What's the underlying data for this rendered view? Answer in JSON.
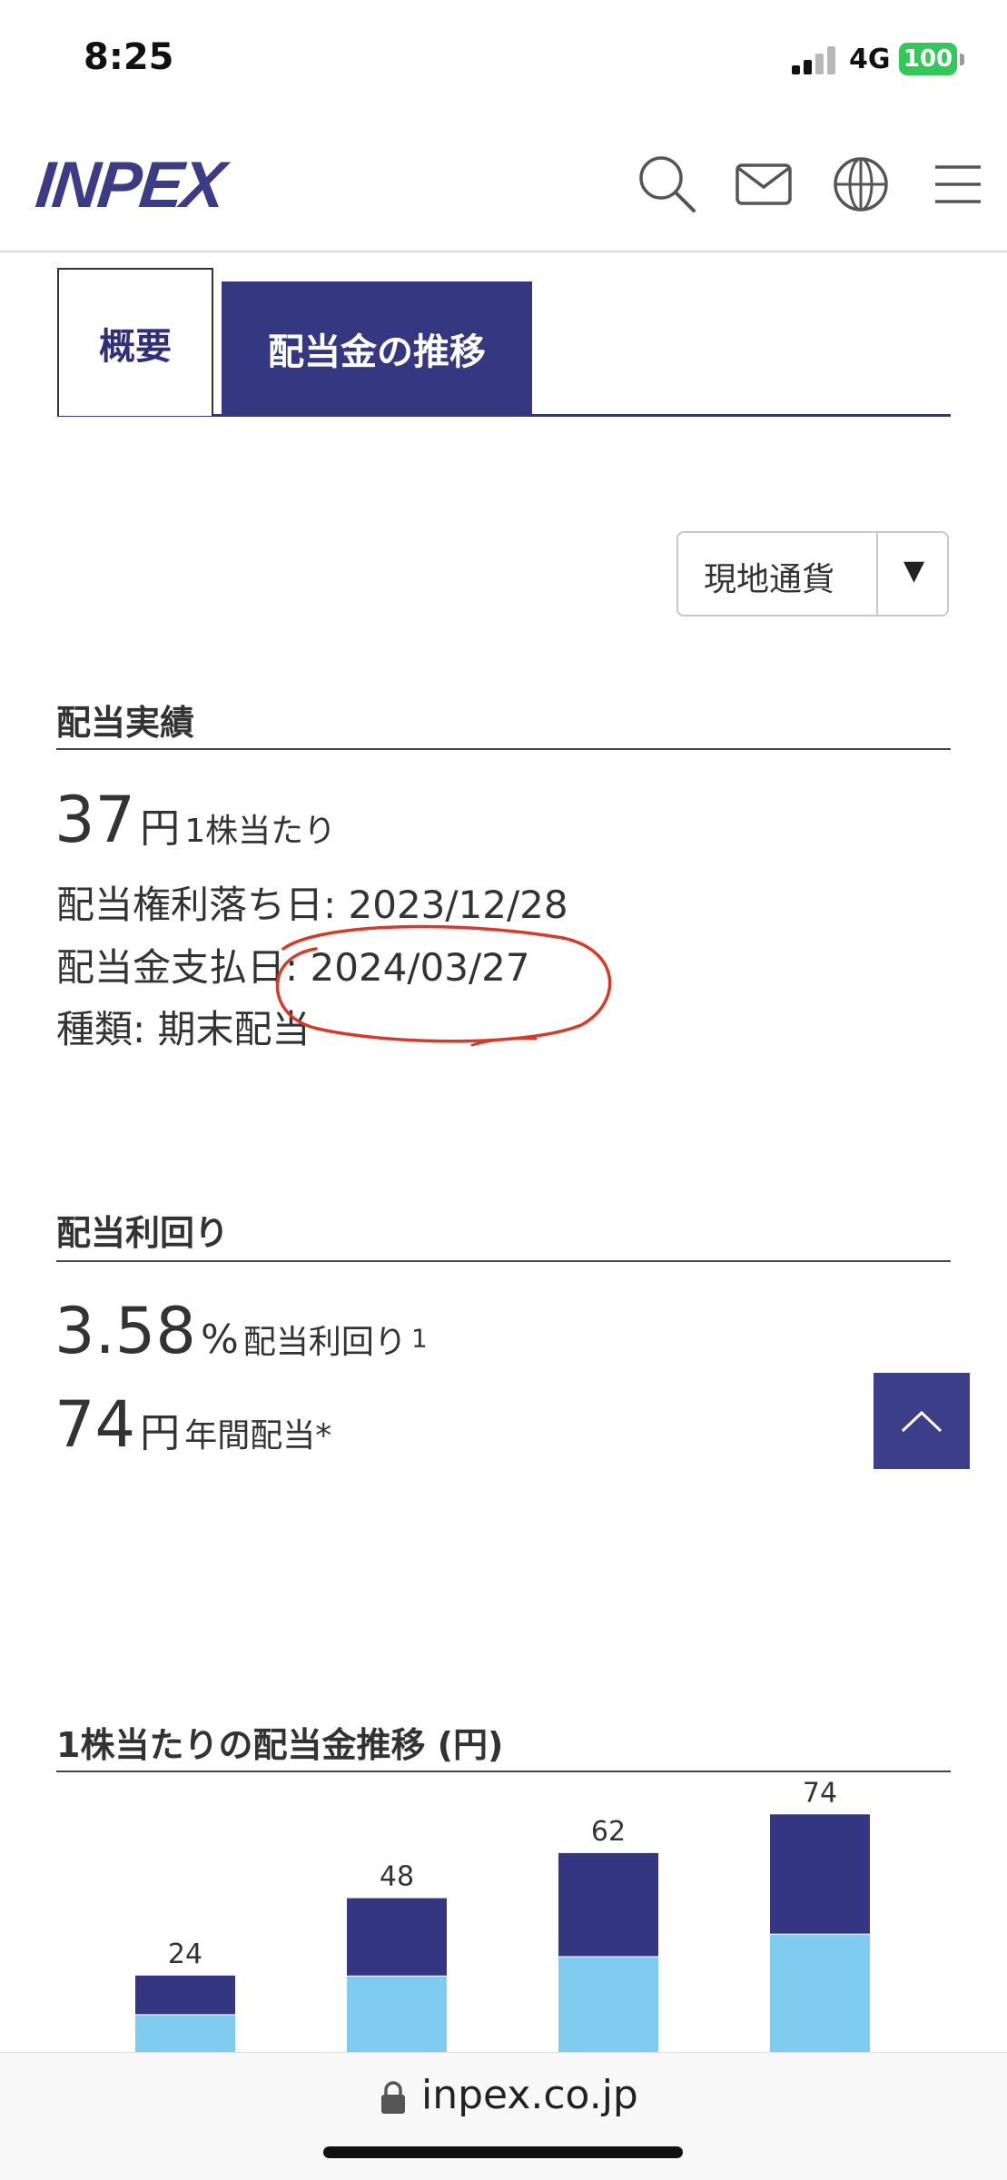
{
  "status_bar": {
    "time": "8:25",
    "network": "4G",
    "battery": "100"
  },
  "header": {
    "logo": "INPEX"
  },
  "tabs": [
    {
      "label": "概要",
      "selected": false
    },
    {
      "label": "配当金の推移",
      "selected": true
    }
  ],
  "currency_select": {
    "value": "現地通貨",
    "arrow": "▼"
  },
  "dividend_results": {
    "title": "配当実績",
    "amount": "37",
    "unit": "円",
    "per_share": "1株当たり",
    "ex_date": "配当権利落ち日: 2023/12/28",
    "pay_date": "配当金支払日: 2024/03/27",
    "type": "種類: 期末配当"
  },
  "dividend_yield": {
    "title": "配当利回り",
    "yield_value": "3.58",
    "yield_unit": "%",
    "yield_label": "配当利回り",
    "yield_note": "1",
    "annual_value": "74",
    "annual_unit": "円",
    "annual_label": "年間配当*"
  },
  "chart_section": {
    "title": "1株当たりの配当金推移 (円)"
  },
  "chart_data": {
    "type": "bar",
    "stacked": true,
    "title": "1株当たりの配当金推移 (円)",
    "totals": [
      24,
      48,
      62,
      74
    ],
    "series": [
      {
        "values": [
          12,
          24,
          30,
          37
        ],
        "color": "#7fccf0"
      },
      {
        "values": [
          12,
          24,
          32,
          37
        ],
        "color": "#343682"
      }
    ],
    "ylim": [
      0,
      80
    ]
  },
  "browser": {
    "url": "inpex.co.jp"
  },
  "colors": {
    "brand": "#353881",
    "accent_light": "#7fccf0"
  }
}
